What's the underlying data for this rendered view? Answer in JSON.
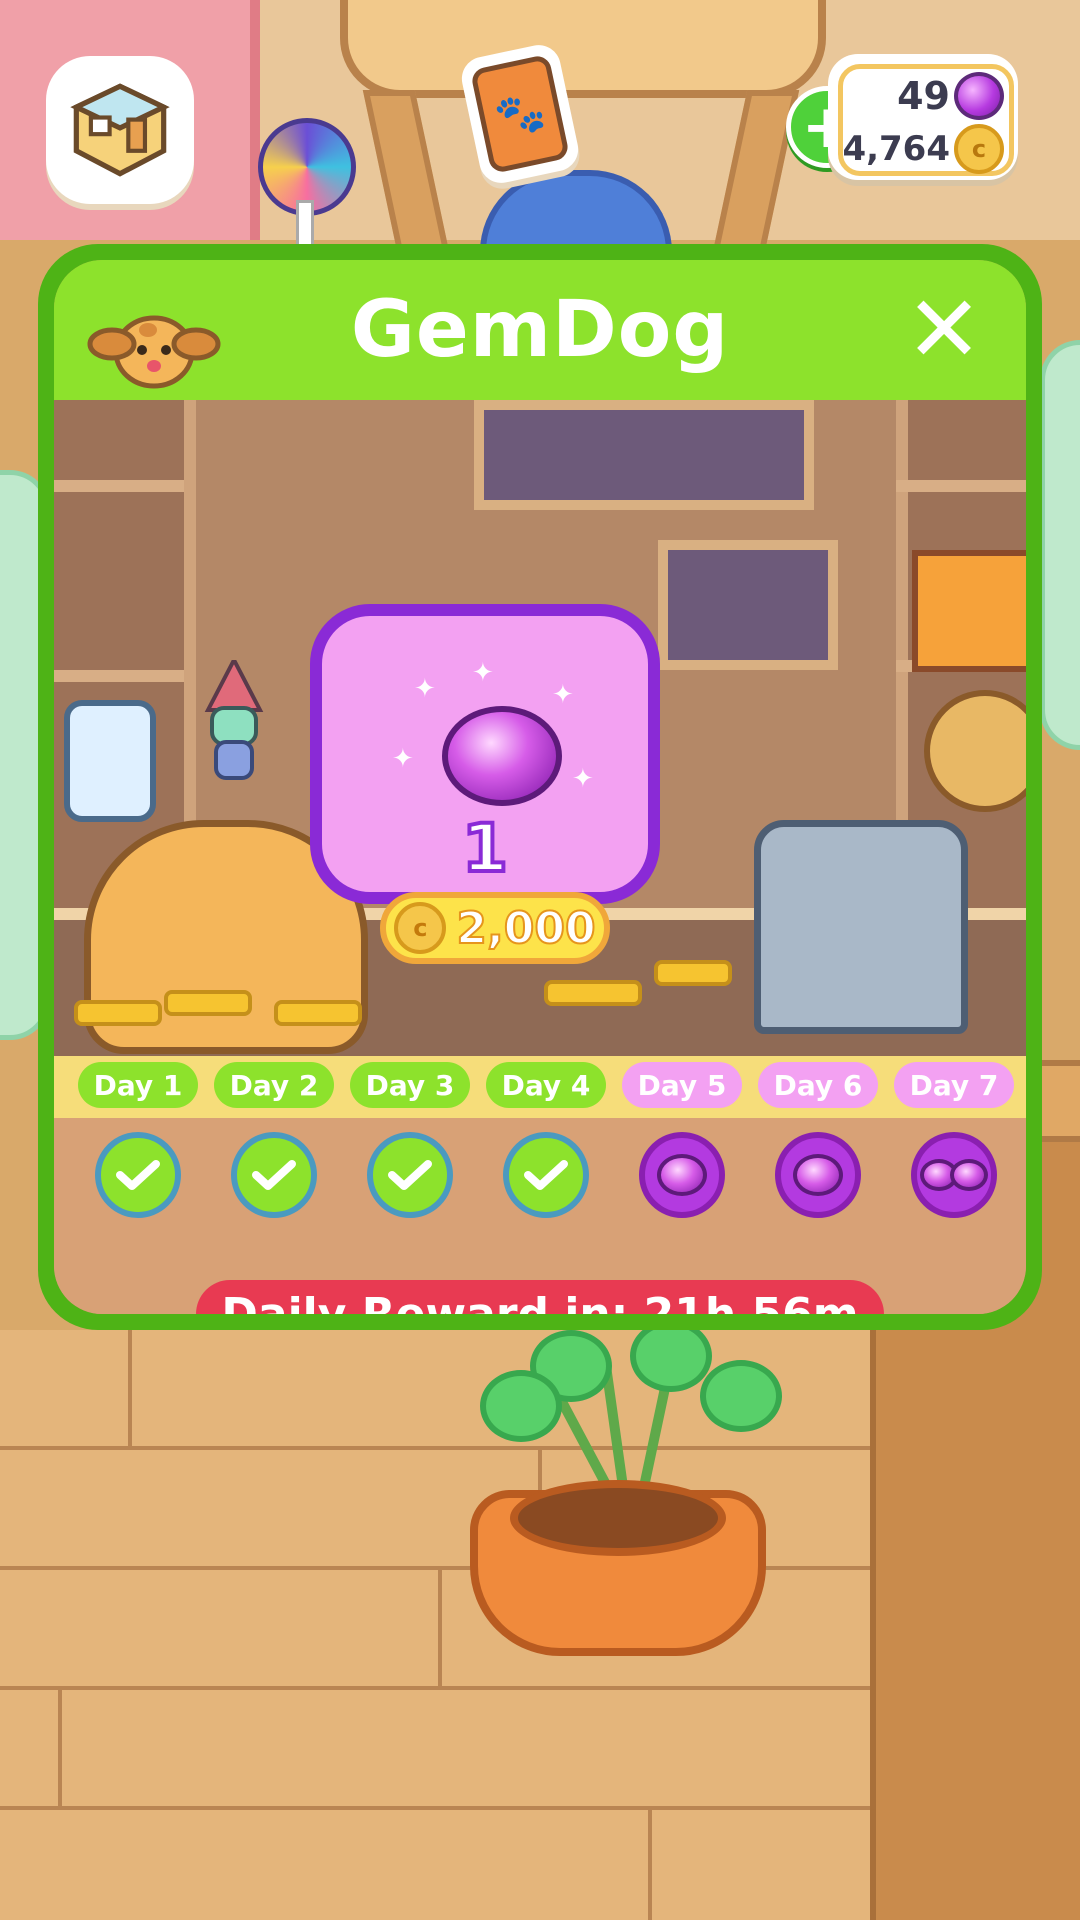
{
  "hud": {
    "gems": "49",
    "coins": "4,764",
    "add_button": "+",
    "coin_symbol": "c"
  },
  "dialog": {
    "title": "GemDog",
    "close": "✕",
    "reward": {
      "amount": "1",
      "price": "2,000",
      "coin_symbol": "c"
    },
    "days": [
      {
        "label": "Day 1",
        "status": "claimed"
      },
      {
        "label": "Day 2",
        "status": "claimed"
      },
      {
        "label": "Day 3",
        "status": "claimed"
      },
      {
        "label": "Day 4",
        "status": "claimed"
      },
      {
        "label": "Day 5",
        "status": "gem"
      },
      {
        "label": "Day 6",
        "status": "gem"
      },
      {
        "label": "Day 7",
        "status": "gems"
      }
    ],
    "timer": "Daily Reward in: 21h 56m"
  },
  "colors": {
    "header_green": "#8de22c",
    "border_green": "#4eb316",
    "gem_purple": "#8a2ad6",
    "day_pill_claimed": "#8de22c",
    "day_pill_upcoming": "#f3a1f2",
    "timer_red": "#e83a52"
  },
  "icons": {
    "house": "room-icon",
    "card": "paw-card-icon",
    "gem": "gem-icon",
    "coin": "coin-icon",
    "dog": "dog-icon",
    "check": "check-icon"
  }
}
